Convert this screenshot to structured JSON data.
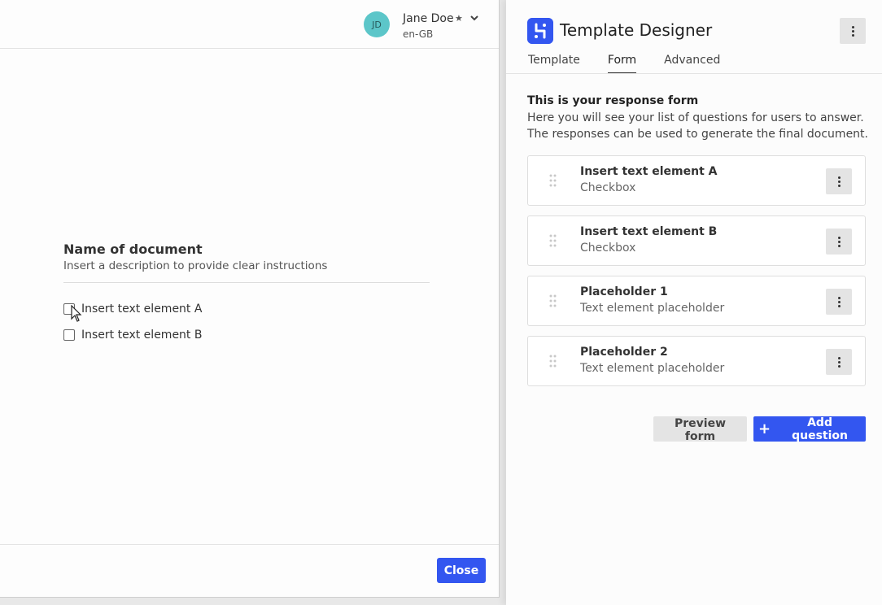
{
  "user": {
    "initials": "JD",
    "name": "Jane Doe",
    "locale": "en-GB"
  },
  "document": {
    "title": "Name of document",
    "description": "Insert a description to provide clear instructions",
    "checkboxes": [
      {
        "label": "Insert text element A",
        "checked": false
      },
      {
        "label": "Insert text element B",
        "checked": false
      }
    ],
    "close_label": "Close"
  },
  "designer": {
    "title": "Template Designer",
    "tabs": [
      {
        "label": "Template",
        "active": false
      },
      {
        "label": "Form",
        "active": true
      },
      {
        "label": "Advanced",
        "active": false
      }
    ],
    "intro_title": "This is your response form",
    "intro_desc": "Here you will see your list of questions for users to answer. The responses can be used to generate the final document.",
    "questions": [
      {
        "title": "Insert text element A",
        "type": "Checkbox"
      },
      {
        "title": "Insert text element B",
        "type": "Checkbox"
      },
      {
        "title": "Placeholder 1",
        "type": "Text element placeholder"
      },
      {
        "title": "Placeholder 2",
        "type": "Text element placeholder"
      }
    ],
    "preview_label": "Preview form",
    "add_label": "Add question"
  },
  "colors": {
    "accent": "#3356f0",
    "avatar": "#5cc6c9"
  },
  "icons": [
    "star-icon",
    "chevron-down-icon",
    "cursor-icon",
    "app-logo-icon",
    "kebab-menu-icon",
    "drag-handle-icon",
    "plus-icon"
  ]
}
